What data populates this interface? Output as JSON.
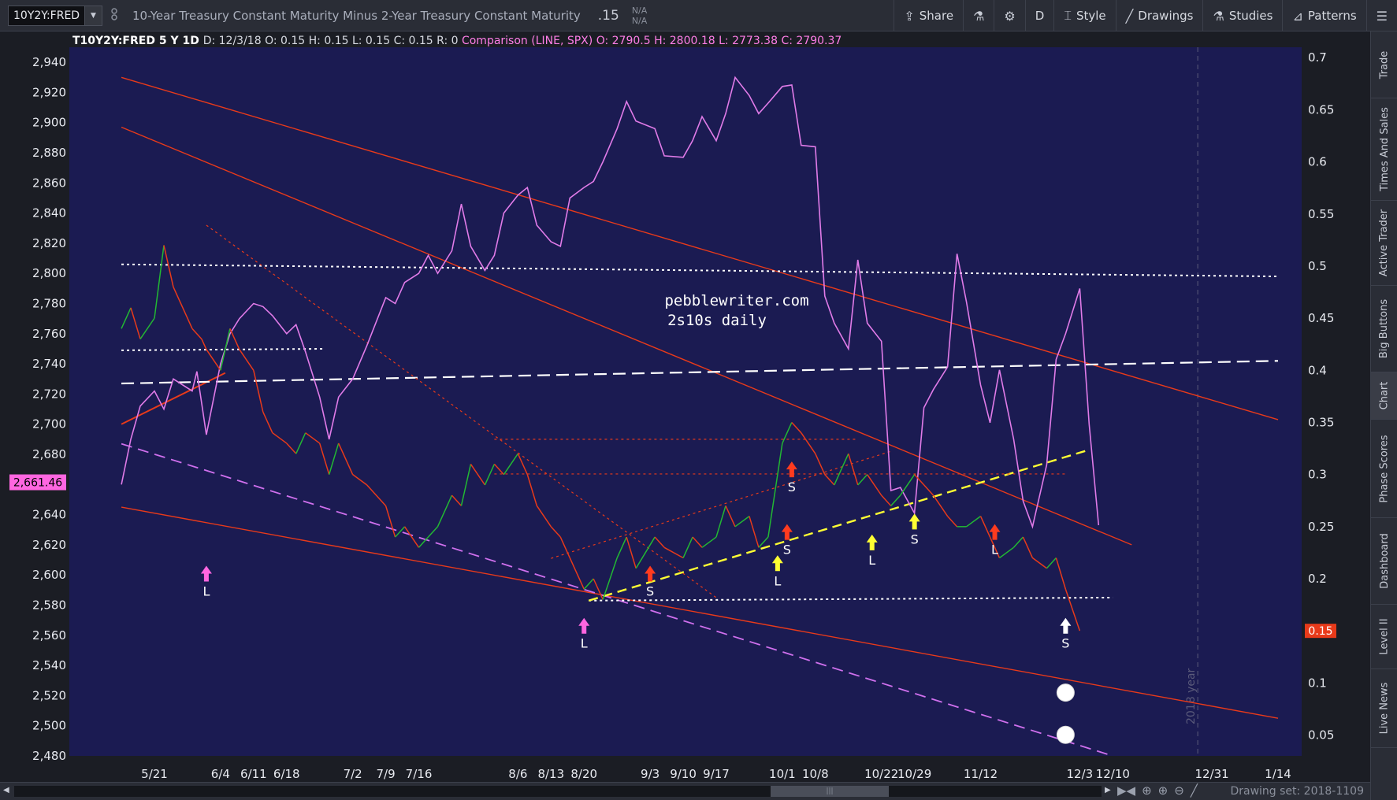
{
  "toolbar": {
    "symbol": "10Y2Y:FRED",
    "dropdown_glyph": "▼",
    "description": "10-Year Treasury Constant Maturity Minus 2-Year Treasury Constant Maturity",
    "last_value": ".15",
    "bid": "N/A",
    "ask": "N/A",
    "buttons": [
      {
        "label": "Share",
        "icon": "share-icon",
        "glyph": "⇪"
      },
      {
        "label": "",
        "icon": "flask-icon",
        "glyph": "⚗"
      },
      {
        "label": "",
        "icon": "gear-icon",
        "glyph": "⚙"
      },
      {
        "label": "D",
        "icon": "",
        "glyph": ""
      },
      {
        "label": "Style",
        "icon": "style-icon",
        "glyph": "⌶"
      },
      {
        "label": "Drawings",
        "icon": "pencil-icon",
        "glyph": "╱"
      },
      {
        "label": "Studies",
        "icon": "studies-flask-icon",
        "glyph": "⚗"
      },
      {
        "label": "Patterns",
        "icon": "patterns-icon",
        "glyph": "⊿"
      },
      {
        "label": "",
        "icon": "menu-icon",
        "glyph": "☰"
      }
    ]
  },
  "header_info": {
    "symbol_period": "T10Y2Y:FRED 5 Y 1D",
    "date": "D: 12/3/18",
    "open": "O: 0.15",
    "high": "H: 0.15",
    "low": "L: 0.15",
    "close": "C: 0.15",
    "r": "R: 0",
    "comparison_label": "Comparison (LINE, SPX)",
    "cmp_open": "O: 2790.5",
    "cmp_high": "H: 2800.18",
    "cmp_low": "L: 2773.38",
    "cmp_close": "C: 2790.37"
  },
  "side_tabs": [
    "Trade",
    "Times And Sales",
    "Active Trader",
    "Big Buttons",
    "Chart",
    "Phase Scores",
    "Dashboard",
    "Level II",
    "Live News"
  ],
  "active_side_tab": "Chart",
  "bottom_bar": {
    "drawing_set": "Drawing set: 2018-1109",
    "scroll_thumb_glyph": "|||",
    "scroll_left_glyph": "◀",
    "scroll_right_glyph": "▶",
    "icons": [
      {
        "name": "zoom-out-arrows-icon",
        "glyph": "▶◀"
      },
      {
        "name": "crosshair-icon",
        "glyph": "⊕"
      },
      {
        "name": "zoom-in-icon",
        "glyph": "⊕"
      },
      {
        "name": "zoom-out-icon",
        "glyph": "⊖"
      },
      {
        "name": "drawing-line-icon",
        "glyph": "╱"
      }
    ]
  },
  "annotations": {
    "watermark_line1": "pebblewriter.com",
    "watermark_line2": "2s10s daily",
    "year_label": "2018 year",
    "signals": [
      {
        "text": "L",
        "x": "6/1",
        "y": 0.22,
        "dir": "up",
        "color": "#ff66e0"
      },
      {
        "text": "L",
        "x": "8/20",
        "y": 0.17,
        "dir": "up",
        "color": "#ff66e0"
      },
      {
        "text": "S",
        "x": "9/3",
        "y": 0.22,
        "dir": "up",
        "color": "#ff3b1f"
      },
      {
        "text": "L",
        "x": "9/30",
        "y": 0.23,
        "dir": "up",
        "color": "#ffff33"
      },
      {
        "text": "S",
        "x": "10/2",
        "y": 0.26,
        "dir": "up",
        "color": "#ff3b1f"
      },
      {
        "text": "S",
        "x": "10/3",
        "y": 0.32,
        "dir": "up",
        "color": "#ff3b1f"
      },
      {
        "text": "L",
        "x": "10/20",
        "y": 0.25,
        "dir": "up",
        "color": "#ffff33"
      },
      {
        "text": "S",
        "x": "10/29",
        "y": 0.27,
        "dir": "up",
        "color": "#ffff33"
      },
      {
        "text": "L",
        "x": "11/15",
        "y": 0.26,
        "dir": "up",
        "color": "#ff3b1f"
      },
      {
        "text": "S",
        "x": "11/30",
        "y": 0.17,
        "dir": "up",
        "color": "#ffffff"
      }
    ]
  },
  "chart_data": {
    "type": "line",
    "left_axis_label": "SPX",
    "right_axis_label": "T10Y2Y:FRED",
    "left_axis": {
      "min": 2480,
      "max": 2950,
      "ticks": [
        "2,480",
        "2,500",
        "2,520",
        "2,540",
        "2,560",
        "2,580",
        "2,600",
        "2,620",
        "2,640",
        "2,660",
        "2,680",
        "2,700",
        "2,720",
        "2,740",
        "2,760",
        "2,780",
        "2,800",
        "2,820",
        "2,840",
        "2,860",
        "2,880",
        "2,900",
        "2,920",
        "2,940"
      ]
    },
    "right_axis": {
      "min": 0.03,
      "max": 0.71,
      "ticks": [
        "0.05",
        "0.1",
        "0.15",
        "0.2",
        "0.25",
        "0.3",
        "0.35",
        "0.4",
        "0.45",
        "0.5",
        "0.55",
        "0.6",
        "0.65",
        "0.7"
      ]
    },
    "x_ticks": [
      "5/21",
      "6/4",
      "6/11",
      "6/18",
      "7/2",
      "7/9",
      "7/16",
      "8/6",
      "8/13",
      "8/20",
      "9/3",
      "9/10",
      "9/17",
      "10/1",
      "10/8",
      "10/22",
      "10/29",
      "11/12",
      "12/3",
      "12/10",
      "12/31",
      "1/14"
    ],
    "current_left_label": "2,661.46",
    "current_right_label": "0.15",
    "spx_series": {
      "name": "SPX",
      "color": "#e07be8",
      "points": [
        [
          "5/14",
          2660
        ],
        [
          "5/16",
          2690
        ],
        [
          "5/18",
          2712
        ],
        [
          "5/21",
          2722
        ],
        [
          "5/23",
          2710
        ],
        [
          "5/25",
          2730
        ],
        [
          "5/29",
          2722
        ],
        [
          "5/30",
          2735
        ],
        [
          "6/1",
          2693
        ],
        [
          "6/4",
          2740
        ],
        [
          "6/6",
          2760
        ],
        [
          "6/8",
          2770
        ],
        [
          "6/11",
          2780
        ],
        [
          "6/13",
          2778
        ],
        [
          "6/15",
          2772
        ],
        [
          "6/18",
          2760
        ],
        [
          "6/20",
          2766
        ],
        [
          "6/22",
          2748
        ],
        [
          "6/25",
          2718
        ],
        [
          "6/27",
          2690
        ],
        [
          "6/29",
          2718
        ],
        [
          "7/2",
          2730
        ],
        [
          "7/5",
          2752
        ],
        [
          "7/9",
          2784
        ],
        [
          "7/11",
          2780
        ],
        [
          "7/13",
          2794
        ],
        [
          "7/16",
          2800
        ],
        [
          "7/18",
          2812
        ],
        [
          "7/20",
          2800
        ],
        [
          "7/23",
          2815
        ],
        [
          "7/25",
          2846
        ],
        [
          "7/27",
          2818
        ],
        [
          "7/30",
          2802
        ],
        [
          "8/1",
          2812
        ],
        [
          "8/3",
          2840
        ],
        [
          "8/6",
          2852
        ],
        [
          "8/8",
          2857
        ],
        [
          "8/10",
          2832
        ],
        [
          "8/13",
          2821
        ],
        [
          "8/15",
          2818
        ],
        [
          "8/17",
          2850
        ],
        [
          "8/20",
          2857
        ],
        [
          "8/22",
          2861
        ],
        [
          "8/24",
          2874
        ],
        [
          "8/27",
          2896
        ],
        [
          "8/29",
          2914
        ],
        [
          "8/31",
          2901
        ],
        [
          "9/4",
          2896
        ],
        [
          "9/6",
          2878
        ],
        [
          "9/10",
          2877
        ],
        [
          "9/12",
          2888
        ],
        [
          "9/14",
          2904
        ],
        [
          "9/17",
          2888
        ],
        [
          "9/19",
          2906
        ],
        [
          "9/21",
          2930
        ],
        [
          "9/24",
          2918
        ],
        [
          "9/26",
          2906
        ],
        [
          "9/28",
          2913
        ],
        [
          "10/1",
          2924
        ],
        [
          "10/3",
          2925
        ],
        [
          "10/5",
          2885
        ],
        [
          "10/8",
          2884
        ],
        [
          "10/10",
          2785
        ],
        [
          "10/12",
          2767
        ],
        [
          "10/15",
          2750
        ],
        [
          "10/17",
          2809
        ],
        [
          "10/19",
          2767
        ],
        [
          "10/22",
          2755
        ],
        [
          "10/24",
          2656
        ],
        [
          "10/26",
          2658
        ],
        [
          "10/29",
          2641
        ],
        [
          "10/31",
          2711
        ],
        [
          "11/2",
          2723
        ],
        [
          "11/5",
          2738
        ],
        [
          "11/7",
          2813
        ],
        [
          "11/9",
          2781
        ],
        [
          "11/12",
          2726
        ],
        [
          "11/14",
          2701
        ],
        [
          "11/16",
          2736
        ],
        [
          "11/19",
          2690
        ],
        [
          "11/21",
          2649
        ],
        [
          "11/23",
          2632
        ],
        [
          "11/26",
          2673
        ],
        [
          "11/28",
          2743
        ],
        [
          "11/30",
          2760
        ],
        [
          "12/3",
          2790
        ],
        [
          "12/5",
          2700
        ],
        [
          "12/7",
          2633
        ]
      ]
    },
    "t10y2y_series": {
      "name": "T10Y2Y:FRED",
      "rising_color": "#22b833",
      "falling_color": "#e83a1a",
      "points": [
        [
          "5/14",
          0.44
        ],
        [
          "5/16",
          0.46
        ],
        [
          "5/18",
          0.43
        ],
        [
          "5/21",
          0.45
        ],
        [
          "5/23",
          0.52
        ],
        [
          "5/25",
          0.48
        ],
        [
          "5/29",
          0.44
        ],
        [
          "5/31",
          0.43
        ],
        [
          "6/1",
          0.42
        ],
        [
          "6/4",
          0.4
        ],
        [
          "6/6",
          0.44
        ],
        [
          "6/8",
          0.42
        ],
        [
          "6/11",
          0.4
        ],
        [
          "6/13",
          0.36
        ],
        [
          "6/15",
          0.34
        ],
        [
          "6/18",
          0.33
        ],
        [
          "6/20",
          0.32
        ],
        [
          "6/22",
          0.34
        ],
        [
          "6/25",
          0.33
        ],
        [
          "6/27",
          0.3
        ],
        [
          "6/29",
          0.33
        ],
        [
          "7/2",
          0.3
        ],
        [
          "7/5",
          0.29
        ],
        [
          "7/9",
          0.27
        ],
        [
          "7/11",
          0.24
        ],
        [
          "7/13",
          0.25
        ],
        [
          "7/16",
          0.23
        ],
        [
          "7/18",
          0.24
        ],
        [
          "7/20",
          0.25
        ],
        [
          "7/23",
          0.28
        ],
        [
          "7/25",
          0.27
        ],
        [
          "7/27",
          0.31
        ],
        [
          "7/30",
          0.29
        ],
        [
          "8/1",
          0.31
        ],
        [
          "8/3",
          0.3
        ],
        [
          "8/6",
          0.32
        ],
        [
          "8/8",
          0.3
        ],
        [
          "8/10",
          0.27
        ],
        [
          "8/13",
          0.25
        ],
        [
          "8/15",
          0.24
        ],
        [
          "8/17",
          0.22
        ],
        [
          "8/20",
          0.19
        ],
        [
          "8/22",
          0.2
        ],
        [
          "8/24",
          0.18
        ],
        [
          "8/27",
          0.22
        ],
        [
          "8/29",
          0.24
        ],
        [
          "8/31",
          0.21
        ],
        [
          "9/4",
          0.24
        ],
        [
          "9/6",
          0.23
        ],
        [
          "9/10",
          0.22
        ],
        [
          "9/12",
          0.24
        ],
        [
          "9/14",
          0.23
        ],
        [
          "9/17",
          0.24
        ],
        [
          "9/19",
          0.27
        ],
        [
          "9/21",
          0.25
        ],
        [
          "9/24",
          0.26
        ],
        [
          "9/26",
          0.23
        ],
        [
          "9/28",
          0.24
        ],
        [
          "10/1",
          0.33
        ],
        [
          "10/3",
          0.35
        ],
        [
          "10/5",
          0.34
        ],
        [
          "10/8",
          0.32
        ],
        [
          "10/10",
          0.3
        ],
        [
          "10/12",
          0.29
        ],
        [
          "10/15",
          0.32
        ],
        [
          "10/17",
          0.29
        ],
        [
          "10/19",
          0.3
        ],
        [
          "10/22",
          0.28
        ],
        [
          "10/24",
          0.27
        ],
        [
          "10/26",
          0.28
        ],
        [
          "10/29",
          0.3
        ],
        [
          "10/31",
          0.29
        ],
        [
          "11/2",
          0.28
        ],
        [
          "11/5",
          0.26
        ],
        [
          "11/7",
          0.25
        ],
        [
          "11/9",
          0.25
        ],
        [
          "11/12",
          0.26
        ],
        [
          "11/14",
          0.24
        ],
        [
          "11/16",
          0.22
        ],
        [
          "11/19",
          0.23
        ],
        [
          "11/21",
          0.24
        ],
        [
          "11/23",
          0.22
        ],
        [
          "11/26",
          0.21
        ],
        [
          "11/28",
          0.22
        ],
        [
          "11/30",
          0.19
        ],
        [
          "12/3",
          0.15
        ]
      ]
    }
  }
}
